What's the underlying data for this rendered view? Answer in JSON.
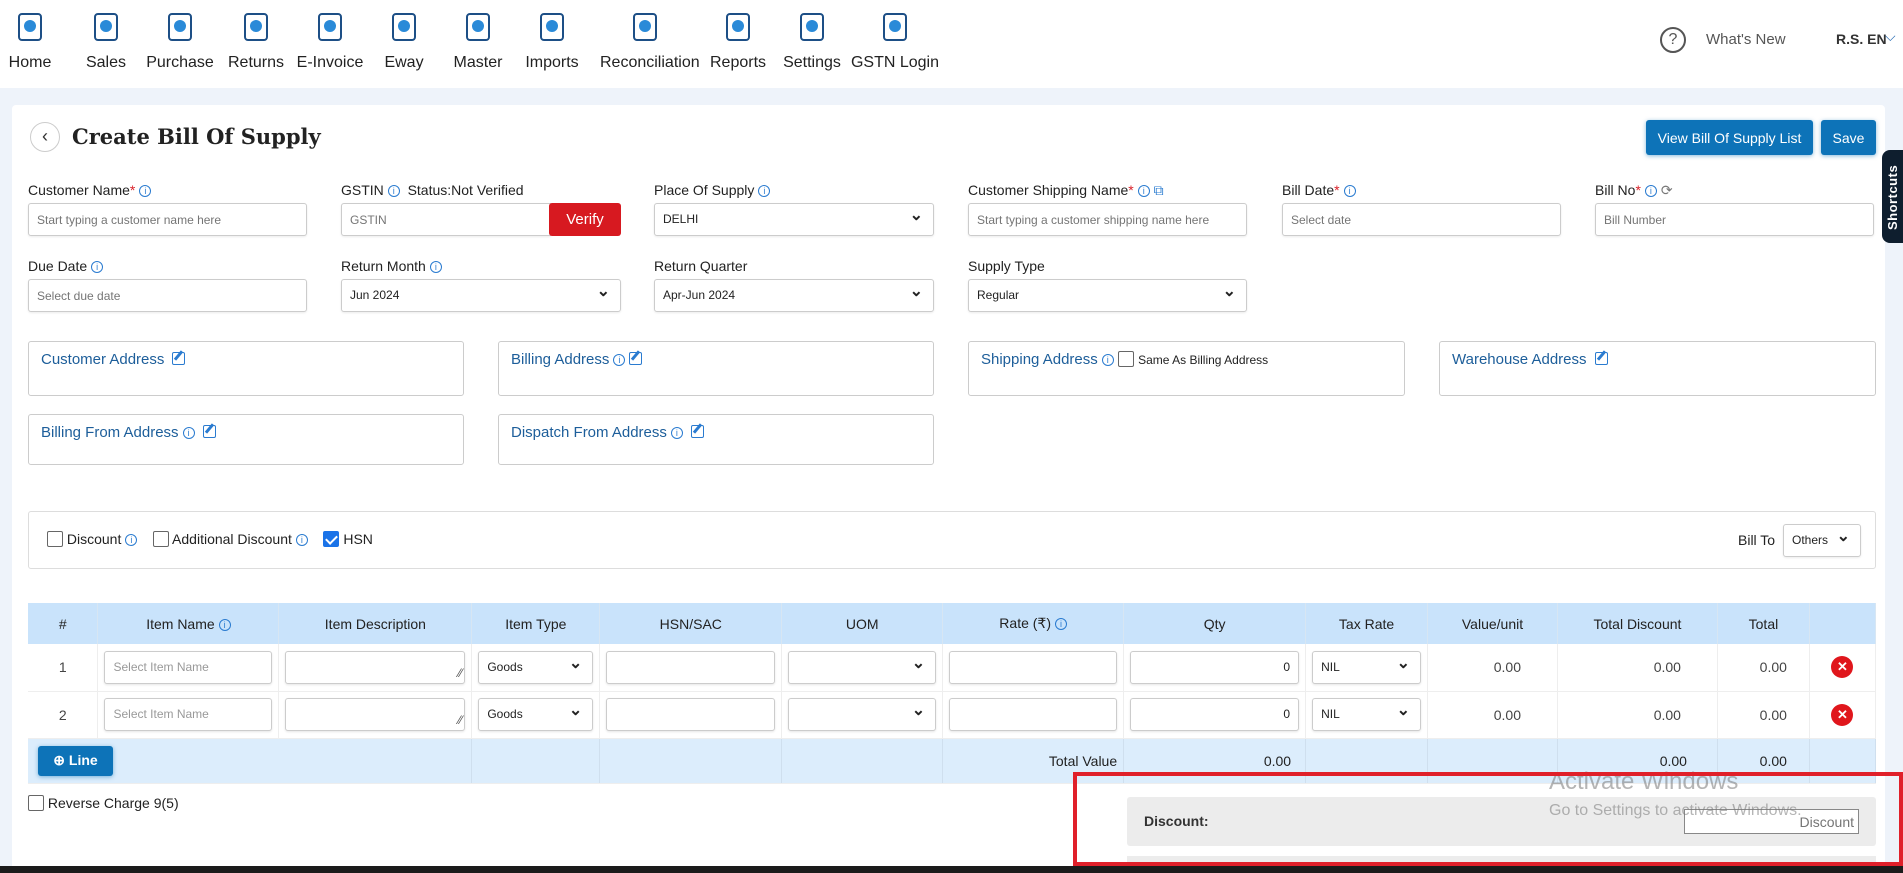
{
  "nav": {
    "items": [
      {
        "label": "Home",
        "icon": "home-icon"
      },
      {
        "label": "Sales",
        "icon": "sales-icon"
      },
      {
        "label": "Purchase",
        "icon": "shopping-bag-icon"
      },
      {
        "label": "Returns",
        "icon": "returns-icon"
      },
      {
        "label": "E-Invoice",
        "icon": "receipt-icon"
      },
      {
        "label": "Eway",
        "icon": "truck-icon"
      },
      {
        "label": "Master",
        "icon": "master-icon"
      },
      {
        "label": "Imports",
        "icon": "import-icon"
      },
      {
        "label": "Reconciliation",
        "icon": "handshake-icon"
      },
      {
        "label": "Reports",
        "icon": "report-icon"
      },
      {
        "label": "Settings",
        "icon": "settings-tools-icon"
      },
      {
        "label": "GSTN Login",
        "icon": "gst-icon"
      }
    ],
    "help": "?",
    "whats_new": "What's New",
    "user": "R.S. EN"
  },
  "page": {
    "title": "Create Bill Of Supply",
    "view_list": "View Bill Of Supply List",
    "save": "Save",
    "shortcuts": "Shortcuts"
  },
  "form": {
    "customer_name": {
      "label": "Customer Name",
      "placeholder": "Start typing a customer name here"
    },
    "gstin": {
      "label": "GSTIN",
      "status": "Status:Not Verified",
      "placeholder": "GSTIN",
      "verify": "Verify"
    },
    "place_of_supply": {
      "label": "Place Of Supply",
      "value": "DELHI"
    },
    "customer_shipping_name": {
      "label": "Customer Shipping Name",
      "placeholder": "Start typing a customer shipping name here"
    },
    "bill_date": {
      "label": "Bill Date",
      "placeholder": "Select date"
    },
    "bill_no": {
      "label": "Bill No",
      "placeholder": "Bill Number"
    },
    "due_date": {
      "label": "Due Date",
      "placeholder": "Select due date"
    },
    "return_month": {
      "label": "Return Month",
      "value": "Jun 2024"
    },
    "return_quarter": {
      "label": "Return Quarter",
      "value": "Apr-Jun 2024"
    },
    "supply_type": {
      "label": "Supply Type",
      "value": "Regular"
    },
    "req": "*",
    "info": "i"
  },
  "addresses": {
    "customer": "Customer Address",
    "billing": "Billing Address",
    "shipping": "Shipping Address",
    "same_as_billing": "Same As Billing Address",
    "warehouse": "Warehouse Address",
    "billing_from": "Billing From Address",
    "dispatch_from": "Dispatch From Address"
  },
  "options": {
    "discount": "Discount",
    "additional_discount": "Additional Discount",
    "hsn": "HSN",
    "hsn_checked": true,
    "bill_to_label": "Bill To",
    "bill_to": "Others"
  },
  "table": {
    "headers": [
      "#",
      "Item Name",
      "Item Description",
      "Item Type",
      "HSN/SAC",
      "UOM",
      "Rate (₹)",
      "Qty",
      "Tax Rate",
      "Value/unit",
      "Total Discount",
      "Total"
    ],
    "rows": [
      {
        "n": "1",
        "item_placeholder": "Select Item Name",
        "type": "Goods",
        "qty": "0",
        "tax": "NIL",
        "value_unit": "0.00",
        "total_discount": "0.00",
        "total": "0.00"
      },
      {
        "n": "2",
        "item_placeholder": "Select Item Name",
        "type": "Goods",
        "qty": "0",
        "tax": "NIL",
        "value_unit": "0.00",
        "total_discount": "0.00",
        "total": "0.00"
      }
    ],
    "add_line": "Line",
    "total_label": "Total Value",
    "total_qty": "0.00",
    "total_discount": "0.00",
    "total": "0.00"
  },
  "reverse_charge": "Reverse Charge 9(5)",
  "summary": {
    "discount_label": "Discount:",
    "discount_placeholder": "Discount"
  },
  "watermark": {
    "line1": "Activate Windows",
    "line2": "Go to Settings to activate Windows."
  },
  "colors": {
    "primary": "#0d73b8",
    "verify": "#d71920",
    "header": "#c9e3fb",
    "highlight": "#e0202a"
  }
}
